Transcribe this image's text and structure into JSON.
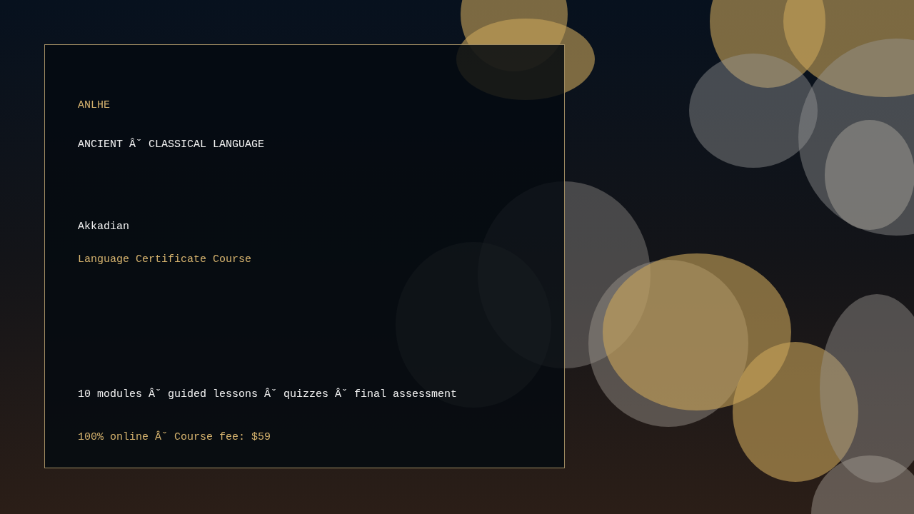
{
  "brand": "ANLHE",
  "category": "ANCIENT Âˇ CLASSICAL LANGUAGE",
  "course": {
    "language": "Akkadian",
    "title": "Language Certificate Course"
  },
  "details": "10 modules Âˇ guided lessons Âˇ quizzes Âˇ final assessment",
  "offer": "100% online Âˇ Course fee: $59"
}
